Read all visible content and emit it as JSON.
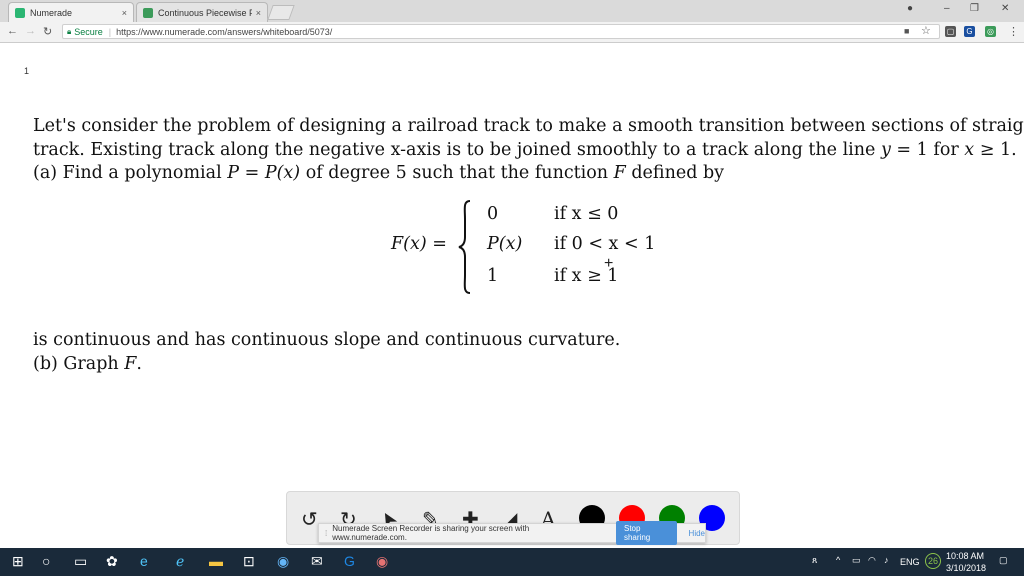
{
  "browser": {
    "tabs": [
      {
        "title": "Numerade",
        "active": true,
        "favicon_color": "#2bb673"
      },
      {
        "title": "Continuous Piecewise F",
        "active": false,
        "favicon_color": "#3c9b5a"
      }
    ],
    "close_glyph": "×",
    "address": {
      "secure_label": "Secure",
      "url": "https://www.numerade.com/answers/whiteboard/5073/"
    },
    "window_controls": {
      "minimize": "–",
      "maximize": "❐",
      "close": "✕"
    }
  },
  "page": {
    "number": "1",
    "problem": {
      "line1": "Let's consider the problem of designing a railroad track to make a smooth transition between sections of straight",
      "line2_a": "track. Existing track along the negative x-axis is to be joined smoothly to a track along the line ",
      "line2_y": "y",
      "line2_b": " = 1 for ",
      "line2_x": "x",
      "line2_c": " ≥ 1.",
      "line3_a": "(a) Find a polynomial ",
      "line3_P": "P",
      "line3_b": " = ",
      "line3_Px": "P(x)",
      "line3_c": " of degree 5 such that the function ",
      "line3_F": "F",
      "line3_d": " defined by",
      "lhs": "F(x) =",
      "cases": [
        {
          "value": "0",
          "cond": "if x ≤ 0"
        },
        {
          "value": "P(x)",
          "cond": "if 0 < x < 1"
        },
        {
          "value": "1",
          "cond": "if x ≥ 1"
        }
      ],
      "line4": "is continuous and has continuous slope and continuous curvature.",
      "line5_a": "(b) Graph ",
      "line5_F": "F",
      "line5_b": "."
    }
  },
  "whiteboard_toolbar": {
    "tools": [
      {
        "name": "undo-icon",
        "glyph": "↺"
      },
      {
        "name": "redo-icon",
        "glyph": "↻"
      },
      {
        "name": "pointer-icon",
        "glyph": "➤"
      },
      {
        "name": "pen-icon",
        "glyph": "✎"
      },
      {
        "name": "add-icon",
        "glyph": "✚"
      },
      {
        "name": "eraser-icon",
        "glyph": "◢"
      },
      {
        "name": "text-icon",
        "glyph": "A"
      }
    ],
    "colors": [
      "#000000",
      "#ff0000",
      "#008000",
      "#0000ff"
    ]
  },
  "share_bar": {
    "message": "Numerade Screen Recorder is sharing your screen with www.numerade.com.",
    "stop_label": "Stop sharing",
    "hide_label": "Hide"
  },
  "taskbar": {
    "language": "ENG",
    "badge": "26",
    "time": "10:08 AM",
    "date": "3/10/2018"
  }
}
